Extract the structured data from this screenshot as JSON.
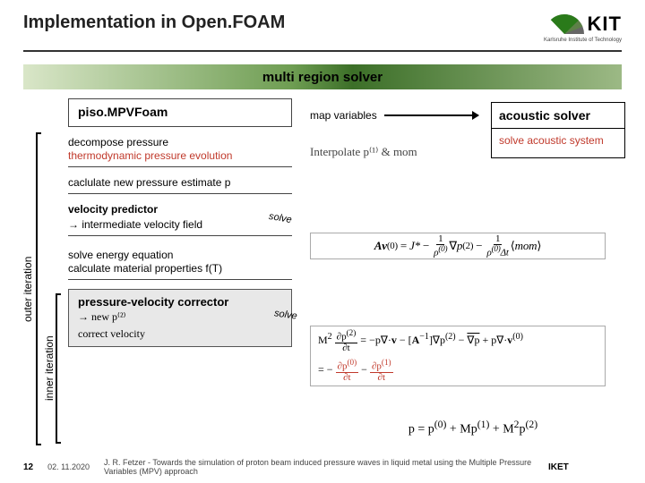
{
  "header": {
    "title": "Implementation in Open.FOAM",
    "logo_text": "KIT",
    "logo_sub": "Karlsruhe Institute of Technology"
  },
  "region_label": "multi region solver",
  "left": {
    "solver_name": "piso.MPVFoam",
    "decompose_l1": "decompose pressure",
    "decompose_l2": "thermodynamic pressure evolution",
    "calc_estimate": "caclulate new pressure estimate p",
    "vel_pred_title": "velocity predictor",
    "vel_pred_sub": "→ intermediate velocity field",
    "energy_l1": "solve energy equation",
    "energy_l2": "calculate material properties f(T)",
    "pv_title": "pressure-velocity corrector",
    "pv_sub": "→ new p⁽²⁾",
    "pv_correct": "correct velocity"
  },
  "iter": {
    "outer": "outer iteration",
    "inner": "inner iteration"
  },
  "right": {
    "map_label": "map variables",
    "acoustic_title": "acoustic solver",
    "acoustic_body": "solve acoustic system",
    "interp": "Interpolate p⁽¹⁾ & mom",
    "solve_tag": "solve",
    "eq1": "Av⁽⁰⁾ = J* − ρ⁽⁰⁾∇p⁽²⁾ − ρ⁽⁰⁾Δt ⟨mom⟩",
    "eq2_l1": "M² ∂p⁽²⁾⁄∂t = −p∇·v − [A⁻¹]∇p⁽²⁾ − ∇p + p∇·v⁽⁰⁾",
    "eq2_l2": "= − ∂p⁽⁰⁾/∂t − ∂p⁽¹⁾/∂t",
    "eq3": "p = p⁽⁰⁾ + Mp⁽¹⁾ + M²p⁽²⁾"
  },
  "footer": {
    "page": "12",
    "date": "02. 11.2020",
    "credit": "J. R. Fetzer - Towards the simulation of proton beam induced pressure waves in liquid metal using the Multiple Pressure Variables (MPV) approach",
    "right": "IKET"
  }
}
